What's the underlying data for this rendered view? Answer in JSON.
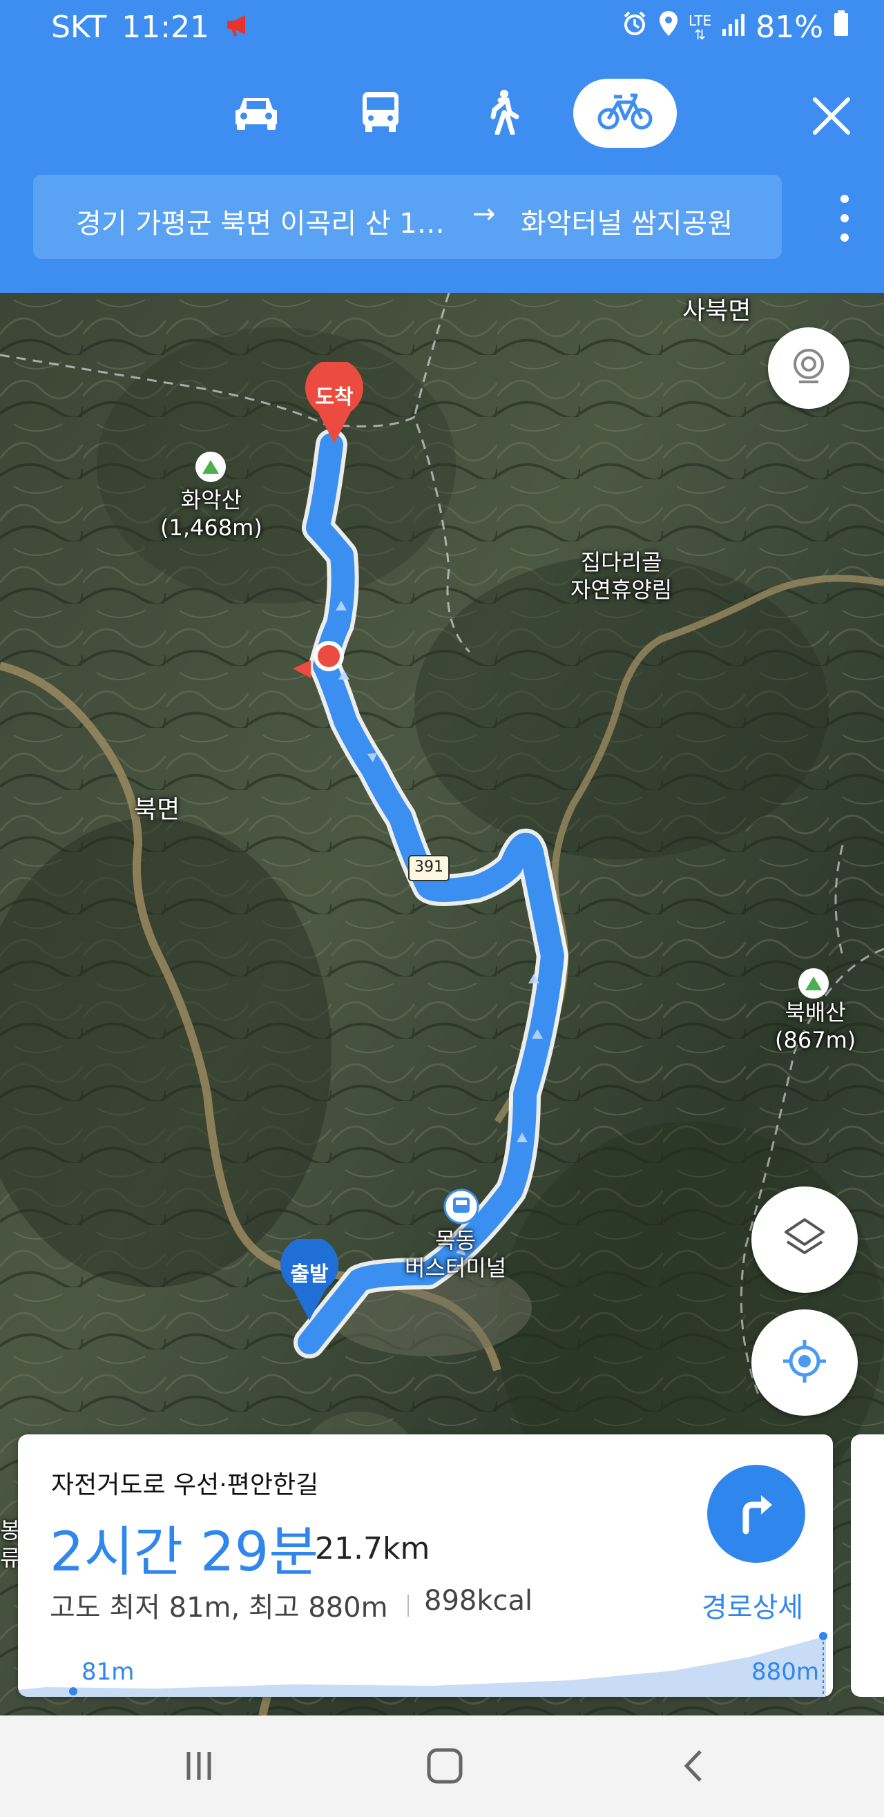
{
  "status_bar": {
    "carrier": "SKT",
    "time": "11:21",
    "network": "LTE",
    "battery": "81%"
  },
  "modes": {
    "items": [
      {
        "name": "car",
        "icon": "car-icon"
      },
      {
        "name": "bus",
        "icon": "bus-icon"
      },
      {
        "name": "walk",
        "icon": "walk-icon"
      },
      {
        "name": "bicycle",
        "icon": "bicycle-icon"
      }
    ],
    "active": "bicycle"
  },
  "route": {
    "from": "경기 가평군 북면 이곡리 산 1…",
    "arrow": "→",
    "to": "화악터널 쌈지공원"
  },
  "map": {
    "labels": {
      "sabuk": "사북면",
      "hwaak_name": "화악산",
      "hwaak_height": "(1,468m)",
      "jipdari_1": "집다리골",
      "jipdari_2": "자연휴양림",
      "bukmyeon": "북면",
      "road_391": "391",
      "bukbae_name": "북배산",
      "bukbae_height": "(867m)",
      "mokdong_1": "목동",
      "mokdong_2": "버스터미널",
      "edge_1": "봉",
      "edge_2": "류"
    },
    "markers": {
      "arrival": "도착",
      "departure": "출발"
    },
    "colors": {
      "route": "#3a8ff0",
      "arrival": "#ec4b3f",
      "departure": "#1f6fd6"
    }
  },
  "card": {
    "title": "자전거도로 우선·편안한길",
    "duration": "2시간 29분",
    "distance": "21.7km",
    "elevation": "고도 최저 81m, 최고 880m",
    "calories": "898kcal",
    "detail_label": "경로상세",
    "elev_min": "81m",
    "elev_max": "880m"
  },
  "accent_color": "#3d8ef0"
}
